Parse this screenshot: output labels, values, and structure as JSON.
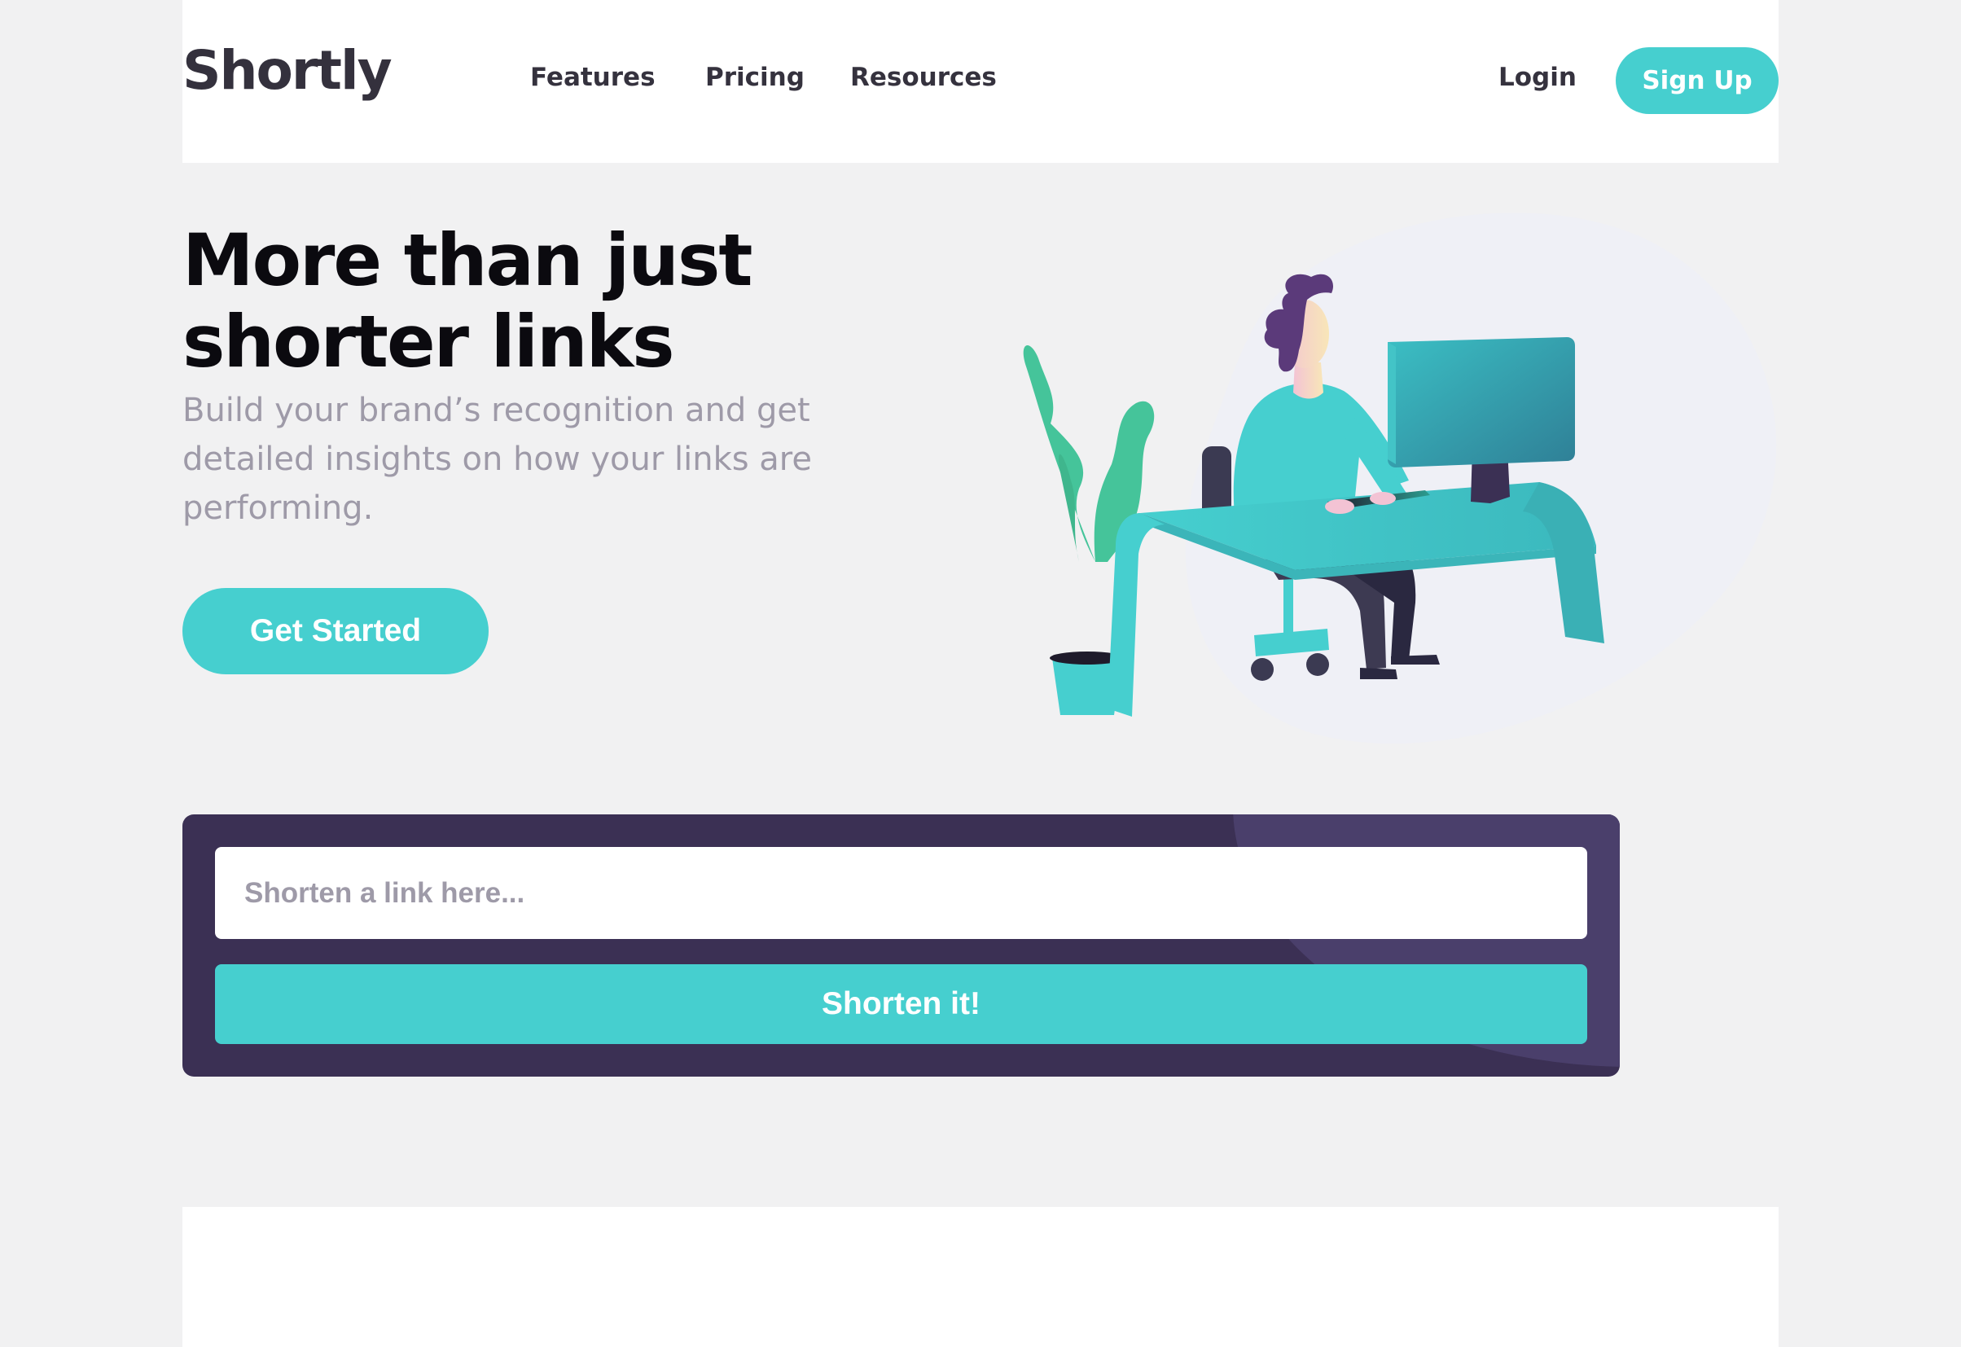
{
  "header": {
    "logo": "Shortly",
    "nav": {
      "features": "Features",
      "pricing": "Pricing",
      "resources": "Resources"
    },
    "login": "Login",
    "signup": "Sign Up"
  },
  "hero": {
    "title": "More than just shorter links",
    "subtitle": "Build your brand’s recognition and get detailed insights on how your links are performing.",
    "cta": "Get Started",
    "illustration_icon": "person-working-illustration"
  },
  "shorten": {
    "placeholder": "Shorten a link here...",
    "value": "",
    "button": "Shorten it!"
  },
  "colors": {
    "primary_cyan": "#46cfcf",
    "dark_violet": "#3b3054",
    "grayish_violet": "#9e9aa8",
    "very_dark_violet": "#35323e",
    "background": "#f1f1f2"
  }
}
